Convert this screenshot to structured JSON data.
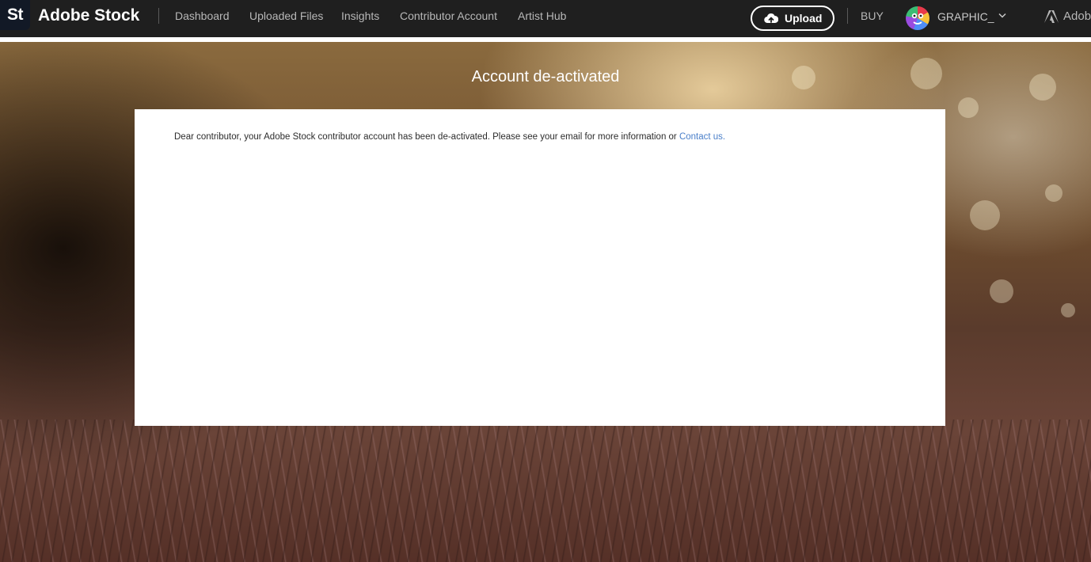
{
  "header": {
    "logo_text": "St",
    "brand": "Adobe Stock",
    "nav": [
      {
        "label": "Dashboard"
      },
      {
        "label": "Uploaded Files"
      },
      {
        "label": "Insights"
      },
      {
        "label": "Contributor Account"
      },
      {
        "label": "Artist Hub"
      }
    ],
    "upload_label": "Upload",
    "buy_label": "BUY",
    "username": "GRAPHIC_",
    "adobe_label": "Adobe"
  },
  "main": {
    "title": "Account de-activated",
    "message": "Dear contributor, your Adobe Stock contributor account has been de-activated. Please see your email for more information or ",
    "contact_link": "Contact us."
  },
  "colors": {
    "topbar": "#1f1f1f",
    "link": "#4a7fc9"
  }
}
